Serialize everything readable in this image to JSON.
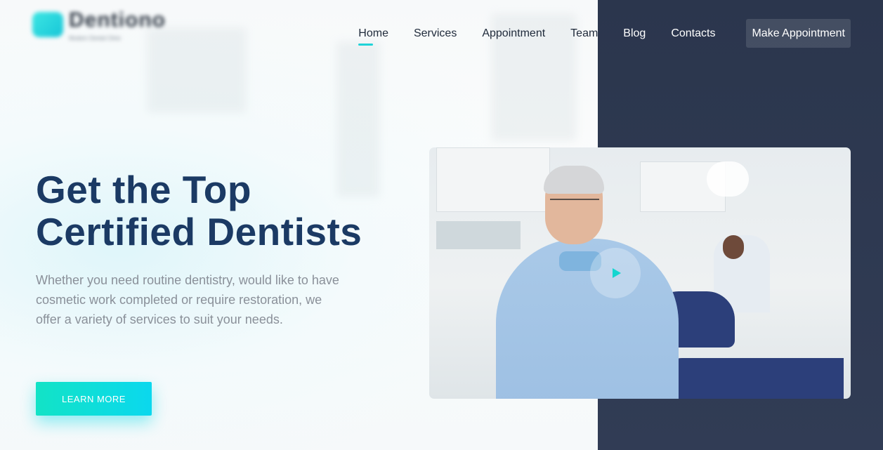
{
  "brand": {
    "logo_name": "Dentiono",
    "logo_tagline": "Modern Dental Clinic"
  },
  "nav": {
    "items": [
      {
        "label": "Home",
        "active": true
      },
      {
        "label": "Services"
      },
      {
        "label": "Appointment"
      },
      {
        "label": "Team"
      },
      {
        "label": "Blog"
      },
      {
        "label": "Contacts"
      }
    ],
    "cta_label": "Make Appointment"
  },
  "hero": {
    "title_line1": "Get the Top",
    "title_line2": "Certified Dentists",
    "description": "Whether you need routine dentistry, would like to have cosmetic work completed or require restoration, we offer a variety of services to suit your needs.",
    "button_label": "LEARN MORE"
  },
  "video": {
    "play_icon": "play-icon"
  },
  "colors": {
    "accent": "#13d6d0",
    "title": "#1b3a64",
    "dark_panel": "#2e3950"
  }
}
